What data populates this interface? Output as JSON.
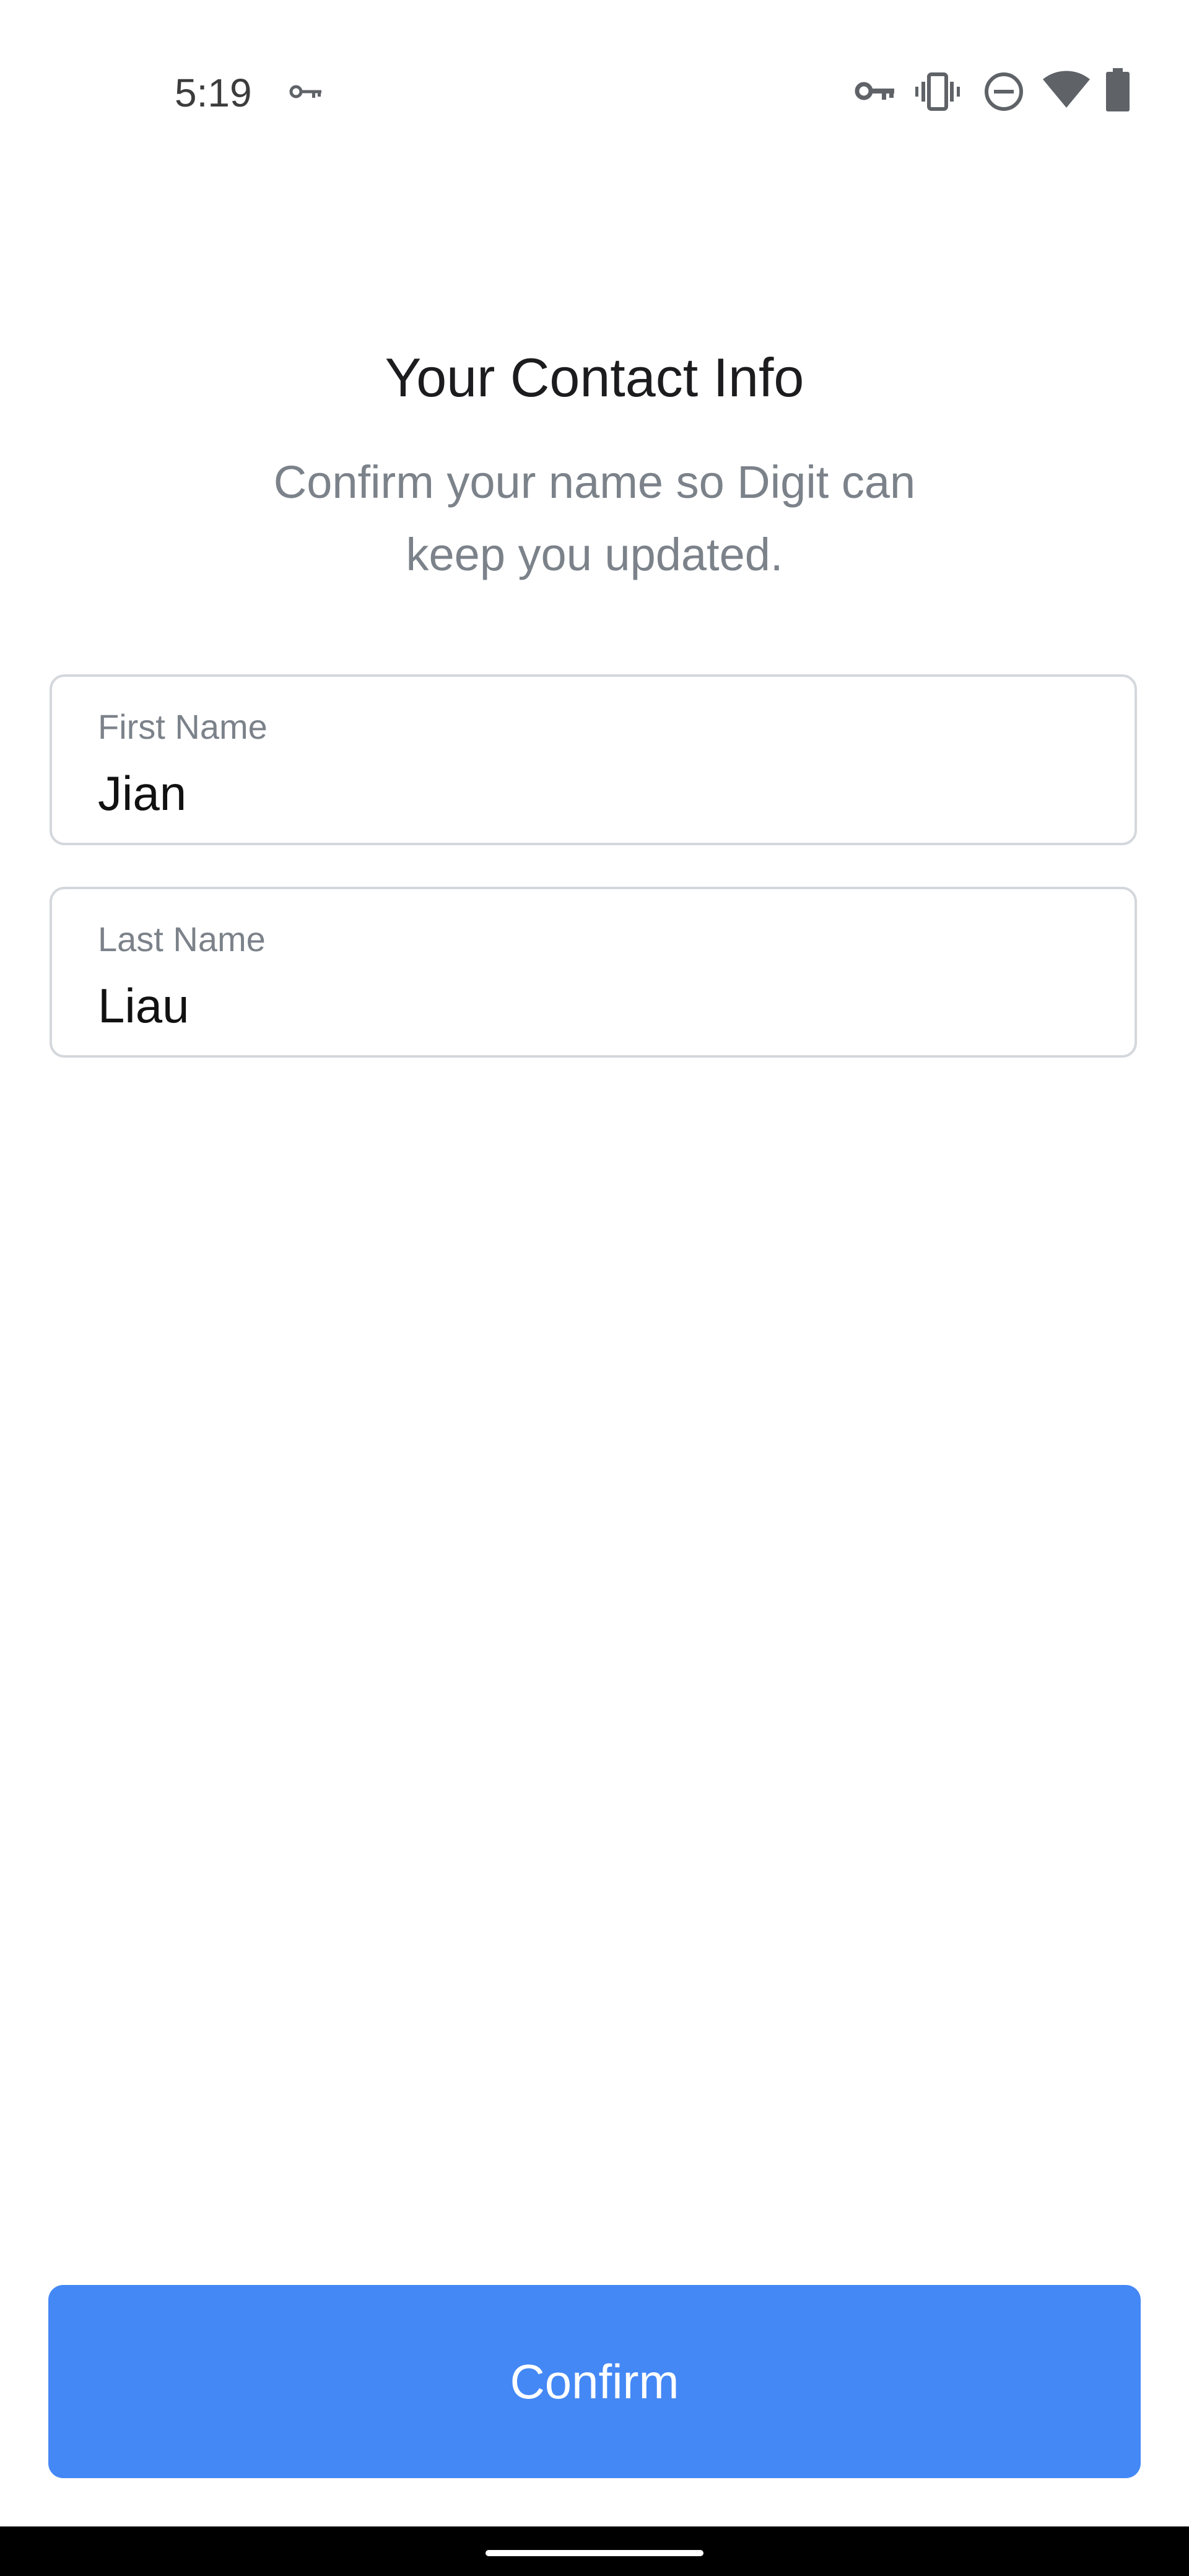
{
  "status_bar": {
    "time": "5:19",
    "icons": [
      "vpn-key-icon",
      "vpn-key-icon",
      "vibrate-icon",
      "do-not-disturb-icon",
      "wifi-icon",
      "battery-icon"
    ]
  },
  "header": {
    "title": "Your Contact Info",
    "subtitle": "Confirm your name so Digit can keep you updated."
  },
  "form": {
    "first_name": {
      "label": "First Name",
      "value": "Jian"
    },
    "last_name": {
      "label": "Last Name",
      "value": "Liau"
    }
  },
  "actions": {
    "confirm_label": "Confirm"
  },
  "colors": {
    "accent": "#4488f6",
    "title": "#1c1c1e",
    "subtitle": "#7c828a",
    "field_border": "#d4d8dc"
  }
}
